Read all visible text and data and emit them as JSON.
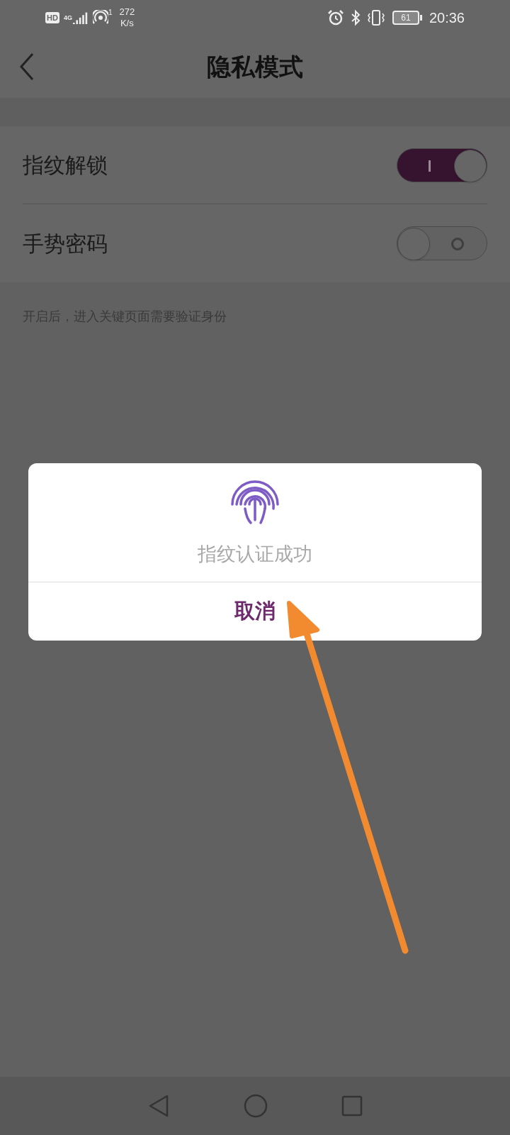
{
  "status_bar": {
    "hd": "HD",
    "network": "4G",
    "hotspot_count": "1",
    "speed": "272",
    "speed_unit": "K/s",
    "battery": "61",
    "time": "20:36"
  },
  "header": {
    "title": "隐私模式"
  },
  "settings": [
    {
      "label": "指纹解锁",
      "on": true
    },
    {
      "label": "手势密码",
      "on": false
    }
  ],
  "hint": "开启后，进入关键页面需要验证身份",
  "dialog": {
    "message": "指纹认证成功",
    "button": "取消"
  },
  "annotation": {
    "kind": "arrow"
  }
}
